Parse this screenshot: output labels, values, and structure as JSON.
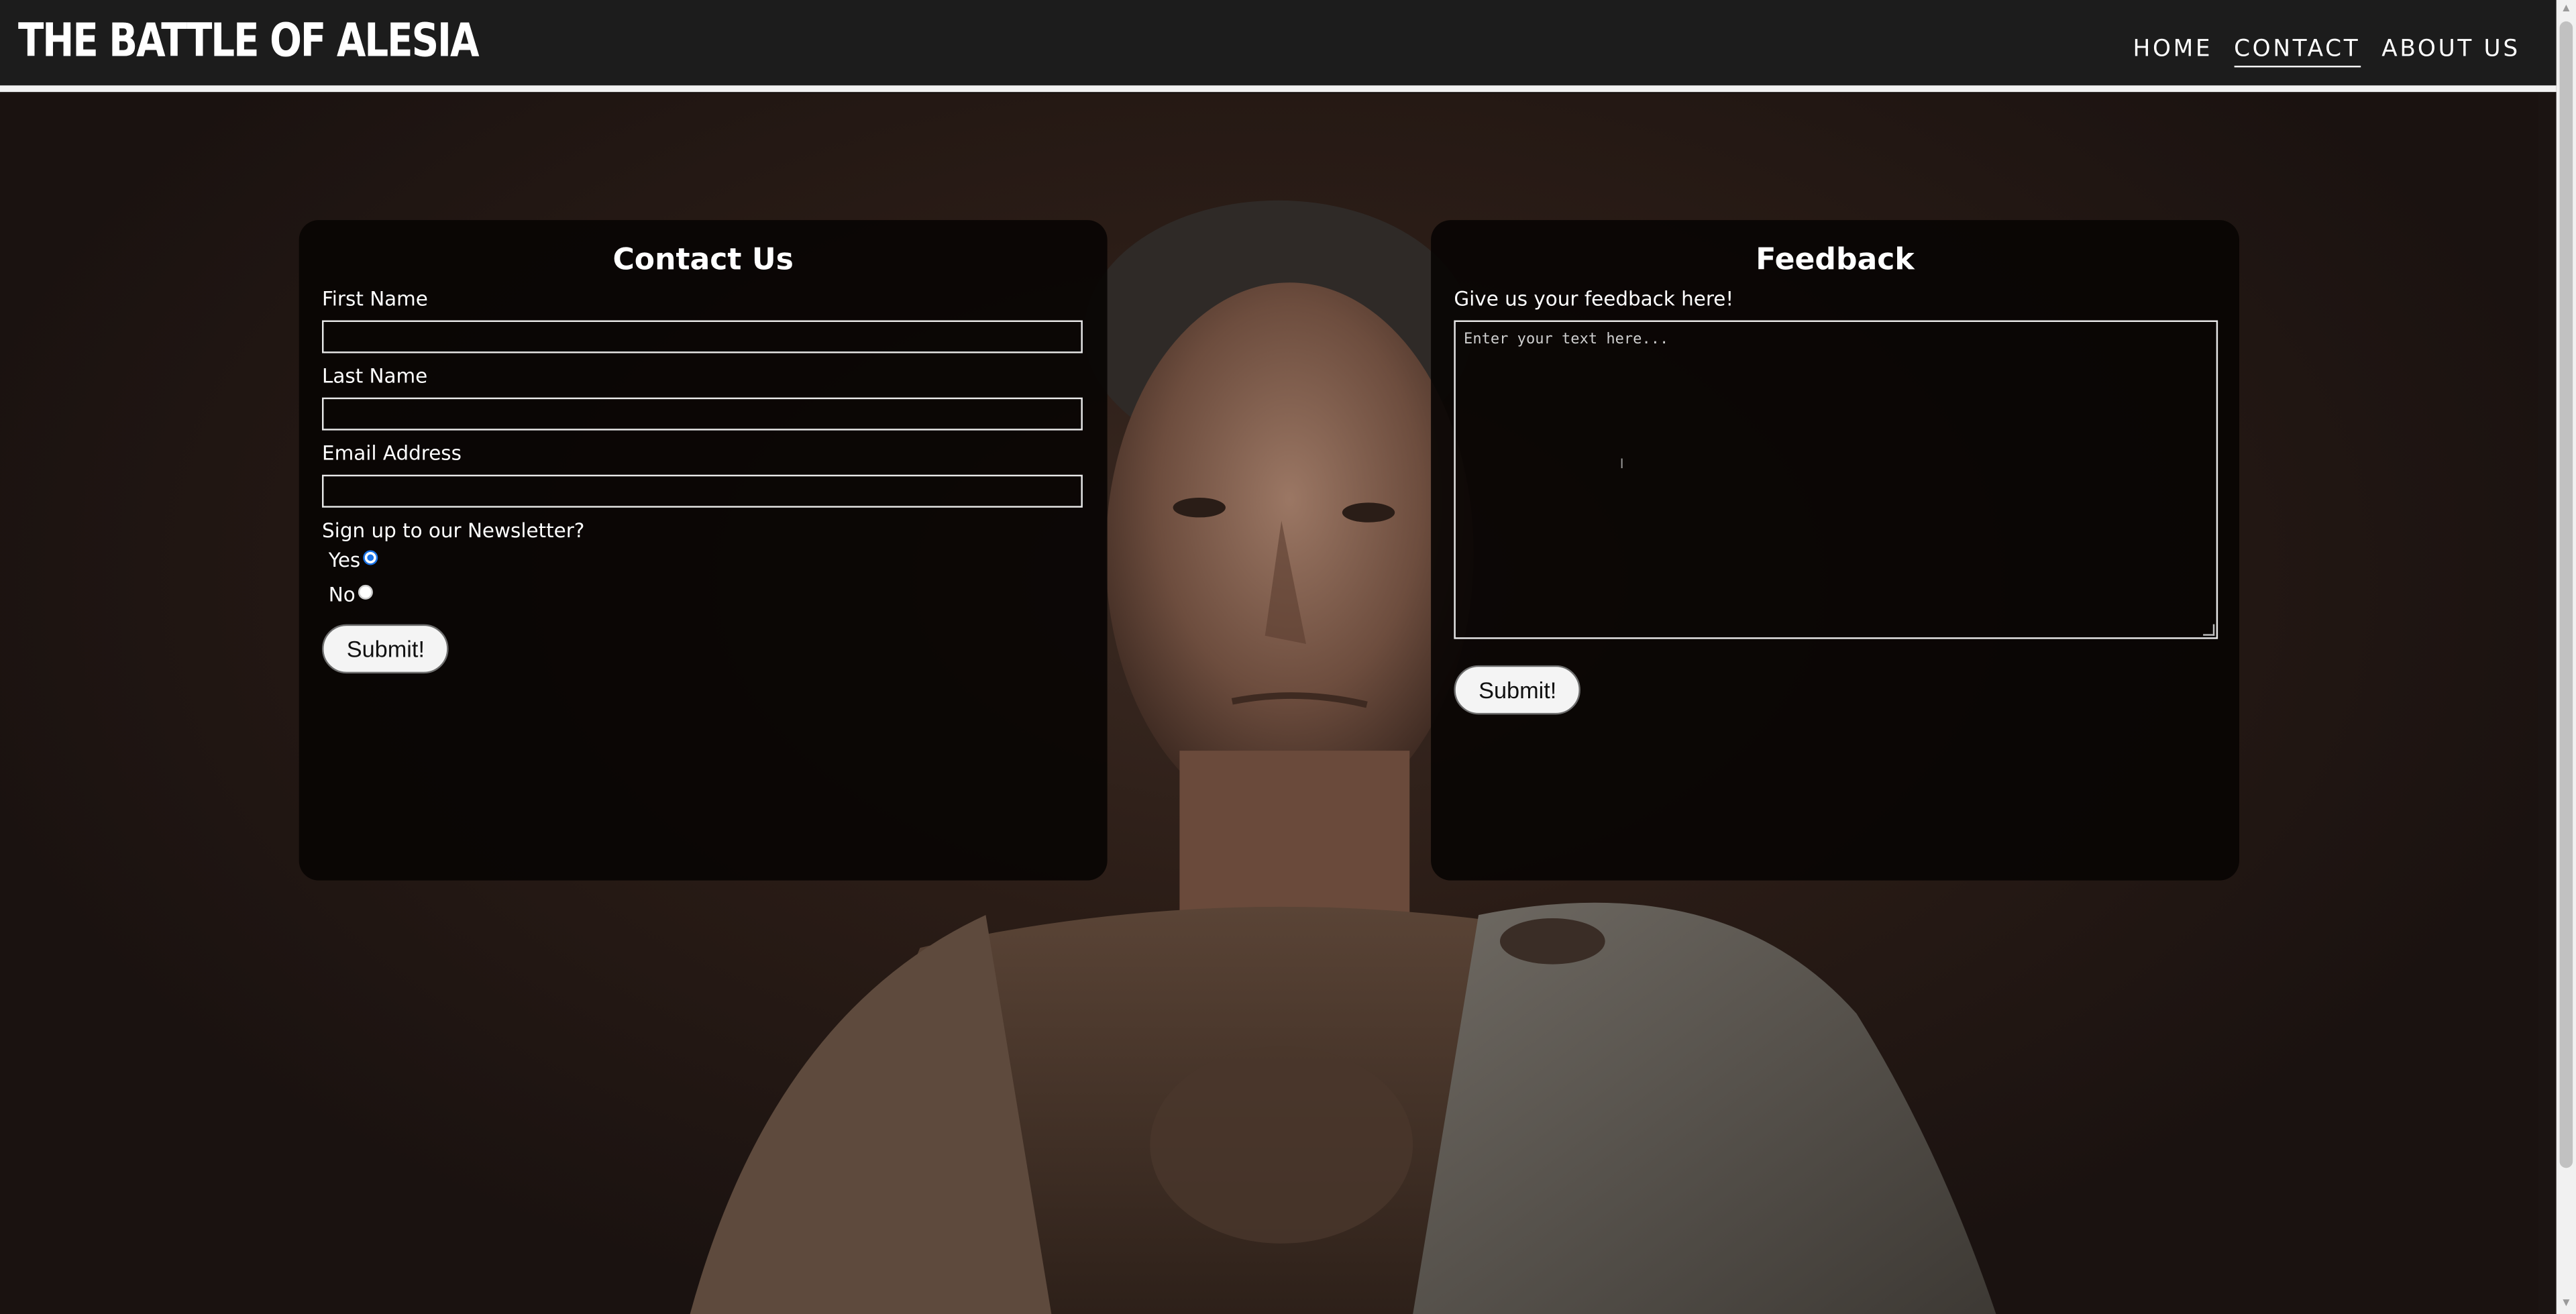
{
  "header": {
    "brand": "THE BATTLE OF ALESIA",
    "nav": [
      {
        "label": "HOME"
      },
      {
        "label": "CONTACT"
      },
      {
        "label": "ABOUT US"
      }
    ]
  },
  "contact": {
    "title": "Contact Us",
    "first_name_label": "First Name",
    "last_name_label": "Last Name",
    "email_label": "Email Address",
    "newsletter_label": "Sign up to our Newsletter?",
    "yes_label": "Yes",
    "no_label": "No",
    "submit_label": "Submit!"
  },
  "feedback": {
    "title": "Feedback",
    "prompt": "Give us your feedback here!",
    "placeholder": "Enter your text here...",
    "submit_label": "Submit!"
  },
  "icons": {
    "text_cursor": "I"
  },
  "colors": {
    "nav_bg": "#1c1c1c",
    "card_bg": "#080403",
    "radio_accent": "#1a73e8"
  }
}
